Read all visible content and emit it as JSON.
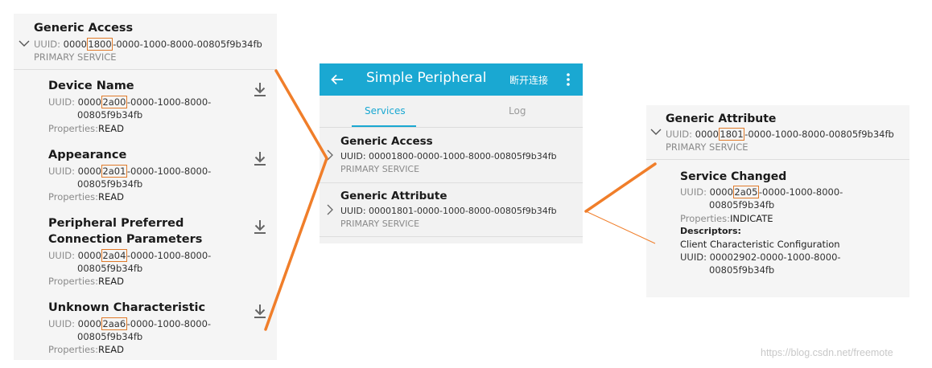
{
  "left": {
    "service": {
      "name": "Generic Access",
      "uuid_label": "UUID:",
      "uuid_pre": "0000",
      "uuid_hl": "1800",
      "uuid_post": "-0000-1000-8000-00805f9b34fb",
      "type": "PRIMARY SERVICE"
    },
    "characteristics": [
      {
        "name": "Device Name",
        "uuid_pre": "0000",
        "uuid_hl": "2a00",
        "uuid_post": "-0000-1000-8000-",
        "uuid_line2": "00805f9b34fb",
        "props_label": "Properties:",
        "props": "READ"
      },
      {
        "name": "Appearance",
        "uuid_pre": "0000",
        "uuid_hl": "2a01",
        "uuid_post": "-0000-1000-8000-",
        "uuid_line2": "00805f9b34fb",
        "props_label": "Properties:",
        "props": "READ"
      },
      {
        "name": "Peripheral Preferred",
        "name_line2": "Connection Parameters",
        "uuid_pre": "0000",
        "uuid_hl": "2a04",
        "uuid_post": "-0000-1000-8000-",
        "uuid_line2": "00805f9b34fb",
        "props_label": "Properties:",
        "props": "READ"
      },
      {
        "name": "Unknown Characteristic",
        "uuid_pre": "0000",
        "uuid_hl": "2aa6",
        "uuid_post": "-0000-1000-8000-",
        "uuid_line2": "00805f9b34fb",
        "props_label": "Properties:",
        "props": "READ"
      }
    ]
  },
  "phone": {
    "title": "Simple Peripheral",
    "disconnect": "断开连接",
    "tabs": [
      "Services",
      "Log"
    ],
    "services": [
      {
        "name": "Generic Access",
        "uuid": "UUID: 00001800-0000-1000-8000-00805f9b34fb",
        "type": "PRIMARY SERVICE"
      },
      {
        "name": "Generic Attribute",
        "uuid": "UUID: 00001801-0000-1000-8000-00805f9b34fb",
        "type": "PRIMARY SERVICE"
      }
    ]
  },
  "right": {
    "service": {
      "name": "Generic Attribute",
      "uuid_label": "UUID:",
      "uuid_pre": "0000",
      "uuid_hl": "1801",
      "uuid_post": "-0000-1000-8000-00805f9b34fb",
      "type": "PRIMARY SERVICE"
    },
    "characteristic": {
      "name": "Service Changed",
      "uuid_pre": "0000",
      "uuid_hl": "2a05",
      "uuid_post": "-0000-1000-8000-",
      "uuid_line2": "00805f9b34fb",
      "props_label": "Properties:",
      "props": "INDICATE",
      "descriptors_label": "Descriptors:",
      "descriptor_name": "Client Characteristic Configuration",
      "descriptor_uuid": "UUID: 00002902-0000-1000-8000-",
      "descriptor_uuid_line2": "00805f9b34fb"
    }
  },
  "watermark": "https://blog.csdn.net/freemote",
  "colors": {
    "appbar": "#1aa8d2",
    "highlight": "#e07a2a",
    "connector": "#f07e2a"
  }
}
